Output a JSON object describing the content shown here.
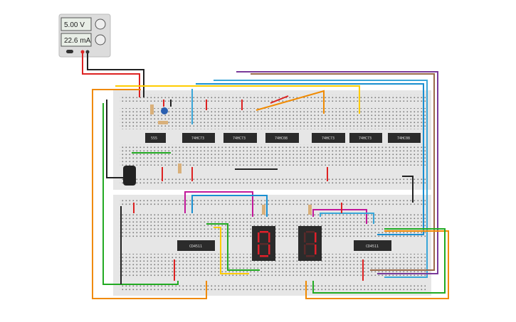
{
  "power_supply": {
    "voltage": "5.00 V",
    "current": "22.6 mA"
  },
  "upper_chips": [
    "555",
    "74HC73",
    "74HC73",
    "74HC08",
    "74HC73",
    "74HC73",
    "74HC08"
  ],
  "lower_chips": [
    "CD4511",
    "CD4511"
  ],
  "displays": [
    {
      "digit": "0"
    },
    {
      "digit": "1"
    }
  ],
  "colors": {
    "breadboard": "#e6e6e6",
    "chip": "#2b2b2b",
    "segment_on": "#e0202a",
    "segment_off": "#5a2a2a"
  }
}
